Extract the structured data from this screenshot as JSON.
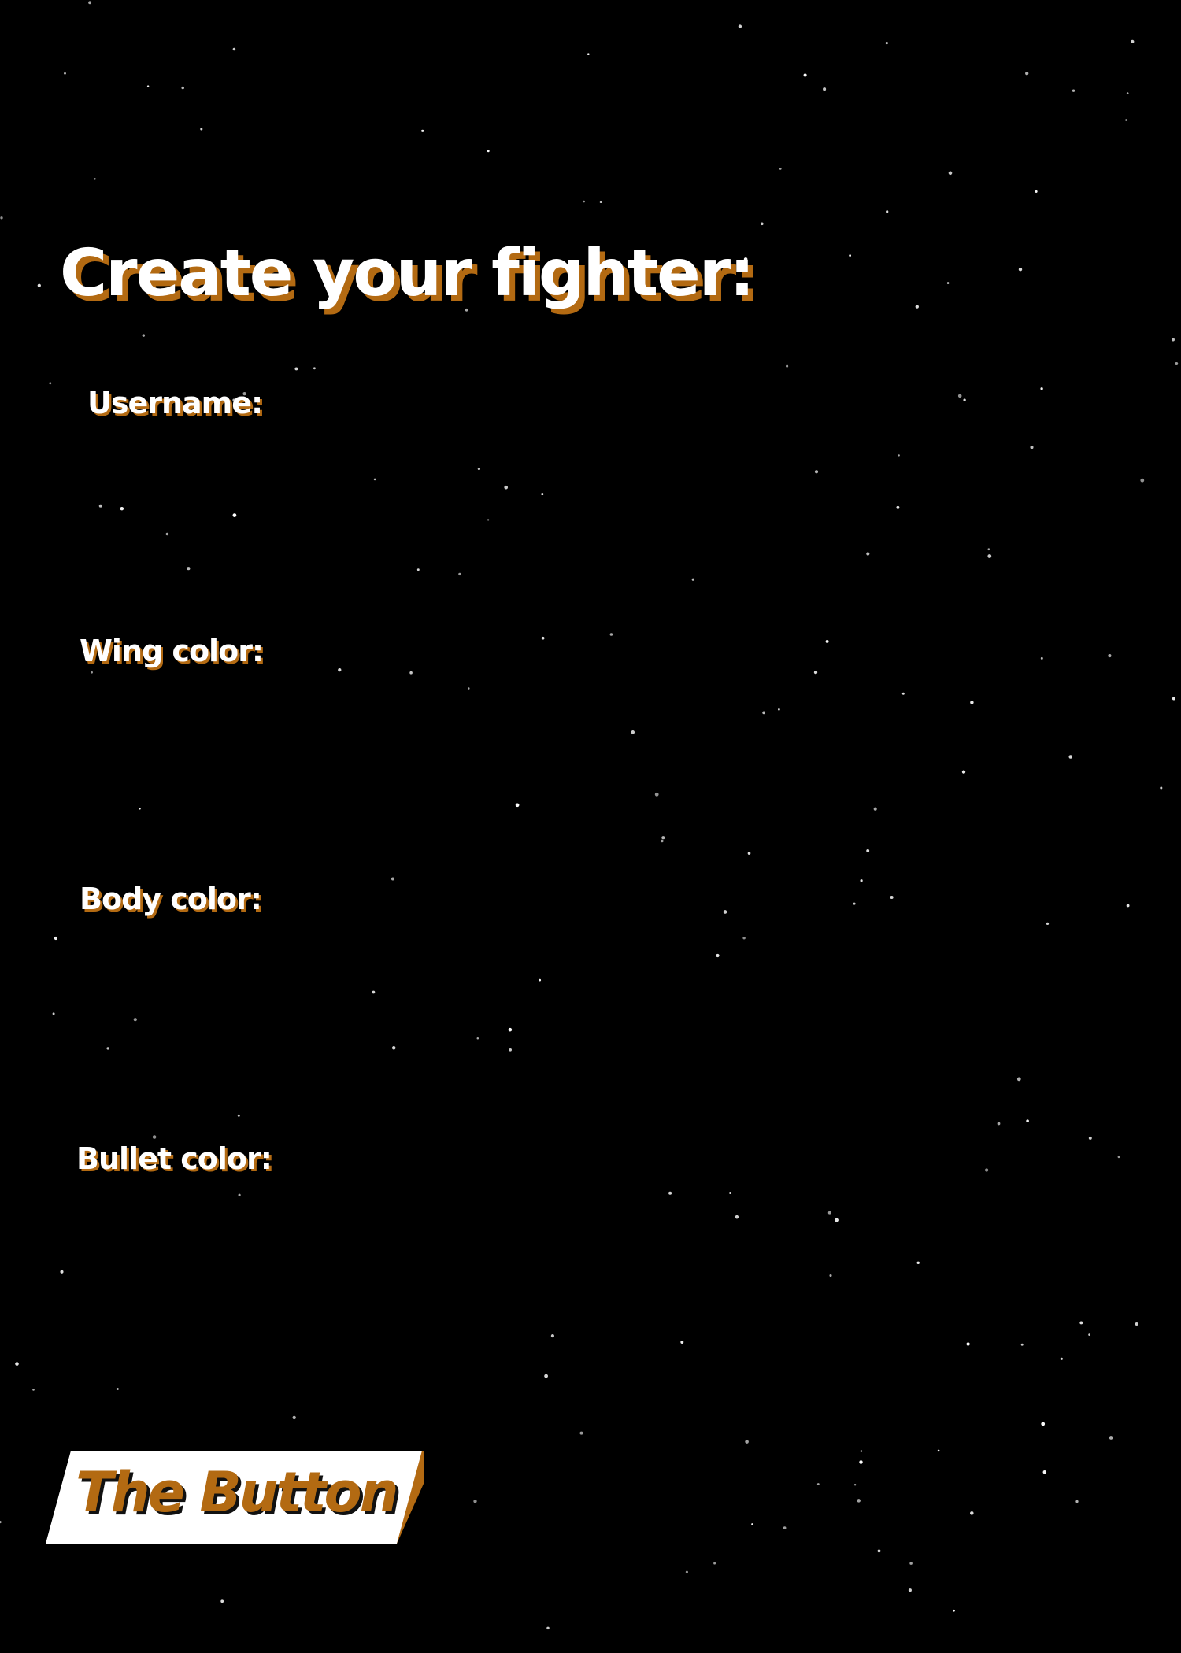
{
  "page": {
    "title": "Create your fighter:",
    "background_color": "#000000",
    "accent_color": "#b36a12",
    "text_color": "#ffffff"
  },
  "form": {
    "username_label": "Username:",
    "wing_color_label": "Wing color:",
    "body_color_label": "Body color:",
    "bullet_color_label": "Bullet color:"
  },
  "submit_button": {
    "label": "The Button",
    "face_color": "#ffffff",
    "side_color": "#b36a12"
  }
}
